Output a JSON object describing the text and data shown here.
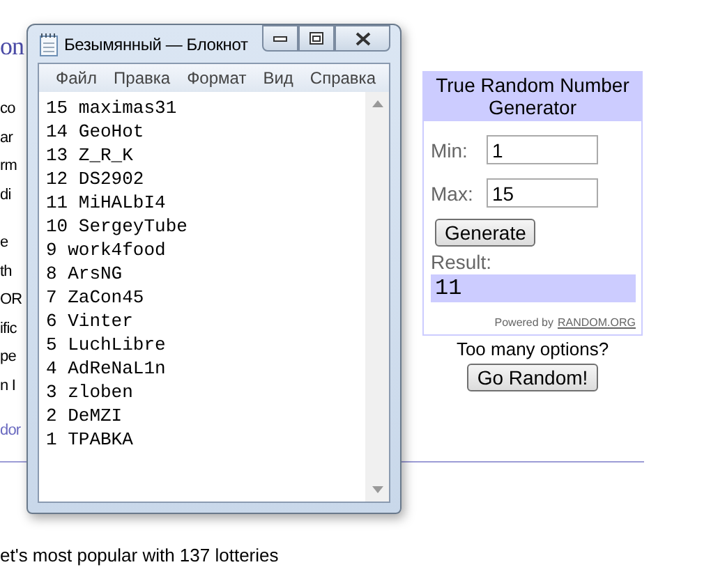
{
  "background_page": {
    "heading": "on",
    "paragraphs": [
      [
        "co",
        "ar",
        "rm",
        "di"
      ],
      [
        "e",
        "th",
        "OR",
        "ific",
        "pe",
        "n I"
      ]
    ],
    "link": "dor",
    "footer": "et's most popular with 137 lotteries"
  },
  "rng_widget": {
    "title": "True Random Number Generator",
    "fields": [
      {
        "label": "Min:",
        "value": "1"
      },
      {
        "label": "Max:",
        "value": "15"
      }
    ],
    "generate_button": "Generate",
    "result_label": "Result:",
    "result": "11",
    "powered_by": "Powered by",
    "powered_link": "RANDOM.ORG",
    "prompt": "Too many options?",
    "go_button": "Go Random!"
  },
  "notepad": {
    "title": "Безымянный — Блокнот",
    "menu": [
      "Файл",
      "Правка",
      "Формат",
      "Вид",
      "Справка"
    ],
    "lines": [
      "15 maximas31",
      "14 GeoHot",
      "13 Z_R_K",
      "12 DS2902",
      "11 MiHALbI4",
      "10 SergeyTube",
      "9 work4food",
      "8 ArsNG",
      "7 ZaCon45",
      "6 Vinter",
      "5 LuchLibre",
      "4 AdReNaL1n",
      "3 zloben",
      "2 DeMZI",
      "1 TPABKA"
    ]
  }
}
